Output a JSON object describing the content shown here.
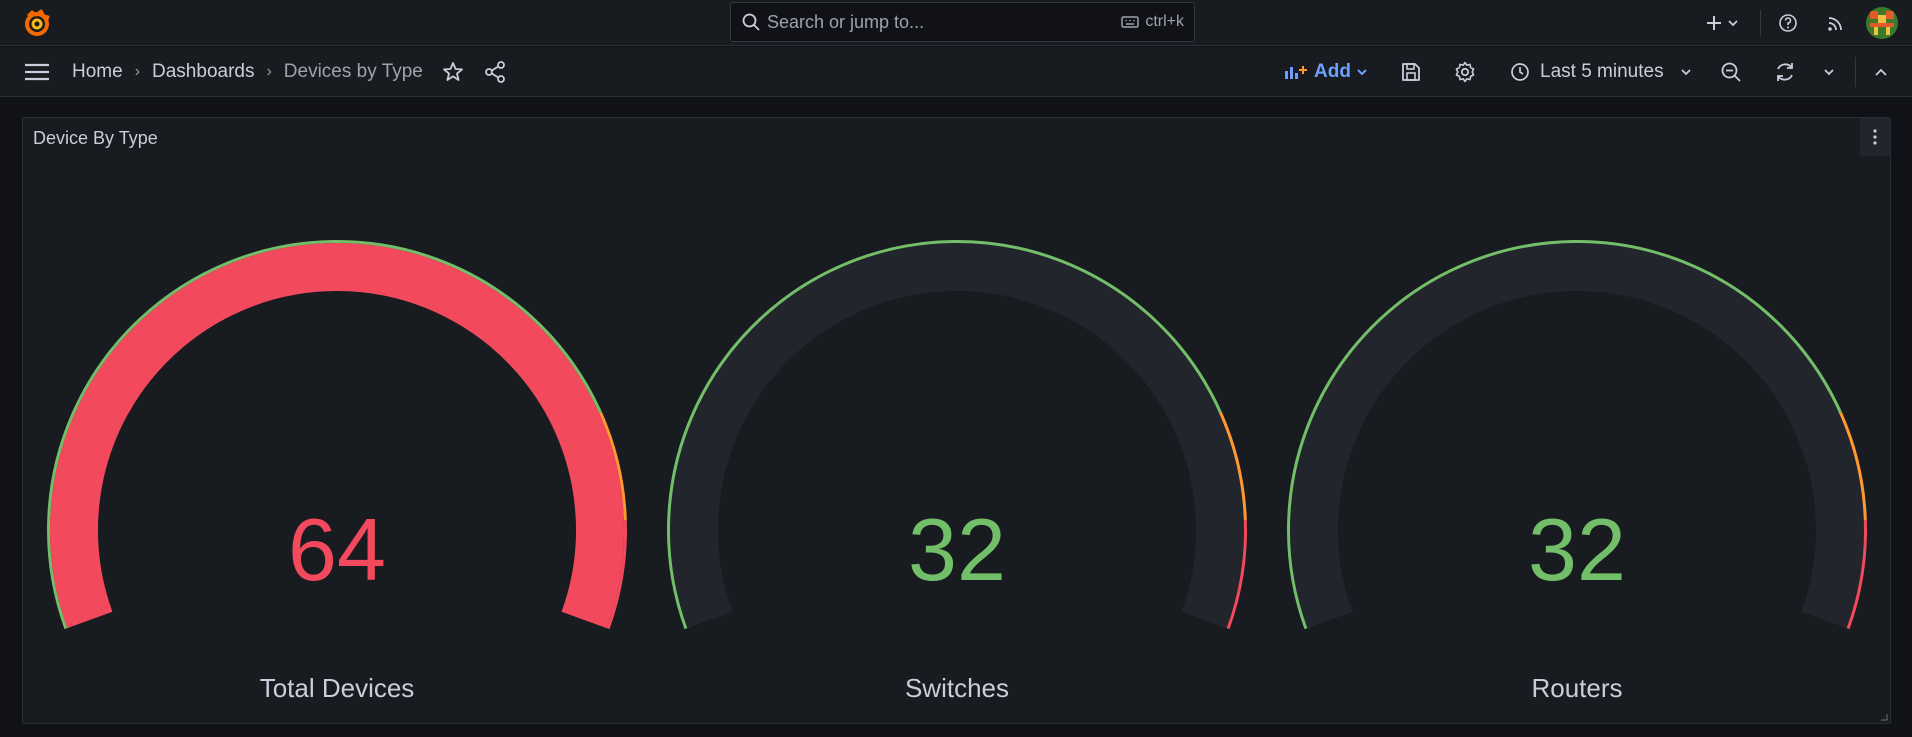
{
  "topbar": {
    "search_placeholder": "Search or jump to...",
    "search_shortcut": "ctrl+k",
    "icons": [
      "grafana-logo-icon",
      "search-icon",
      "keyboard-icon",
      "plus-icon",
      "chevron-down-icon",
      "help-icon",
      "news-feed-icon",
      "user-avatar"
    ]
  },
  "navbar": {
    "breadcrumbs": [
      "Home",
      "Dashboards",
      "Devices by Type"
    ],
    "breadcrumb_separator": "›",
    "add_label": "Add",
    "time_range": "Last 5 minutes"
  },
  "panel": {
    "title": "Device By Type",
    "gauges": [
      {
        "label": "Total Devices",
        "value": "64",
        "fraction": 1.0,
        "color": "#f2495c"
      },
      {
        "label": "Switches",
        "value": "32",
        "fraction": 0.0,
        "color": "#73bf69"
      },
      {
        "label": "Routers",
        "value": "32",
        "fraction": 0.0,
        "color": "#73bf69"
      }
    ]
  },
  "colors": {
    "green": "#73bf69",
    "orange": "#ff9830",
    "red": "#f2495c",
    "accent_blue": "#6e9fff",
    "gauge_track": "#22252b"
  }
}
